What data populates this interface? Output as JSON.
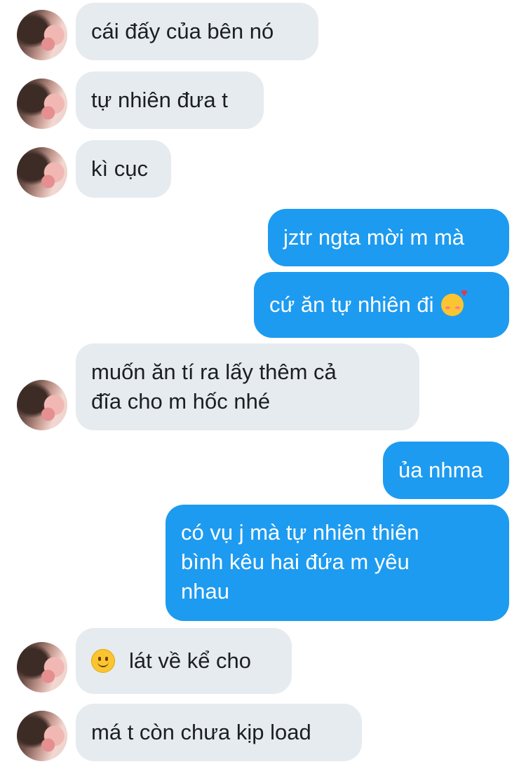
{
  "messages": [
    {
      "side": "in",
      "text": "cái đấy của bên nó"
    },
    {
      "side": "in",
      "text": "tự nhiên đưa t"
    },
    {
      "side": "in",
      "text": "kì cục"
    },
    {
      "side": "out",
      "text": "jztr ngta mời m mà"
    },
    {
      "side": "out",
      "text": "cứ ăn tự nhiên đi",
      "emoji": "smiling-face-with-hearts-icon"
    },
    {
      "side": "in",
      "lines": [
        "muốn ăn tí ra lấy thêm cả",
        "đĩa cho m hốc nhé"
      ]
    },
    {
      "side": "out",
      "text": "ủa nhma"
    },
    {
      "side": "out",
      "lines": [
        "có vụ j mà tự nhiên thiên",
        "bình kêu hai đứa m yêu",
        "nhau"
      ]
    },
    {
      "side": "in",
      "text": "lát về kể cho",
      "emoji": "slightly-smiling-face-icon"
    },
    {
      "side": "in",
      "text": "má t còn chưa kịp load"
    }
  ],
  "colors": {
    "incoming_bubble": "#e6ebef",
    "outgoing_bubble": "#1d9bf0",
    "incoming_text": "#1b1f23",
    "outgoing_text": "#ffffff"
  }
}
